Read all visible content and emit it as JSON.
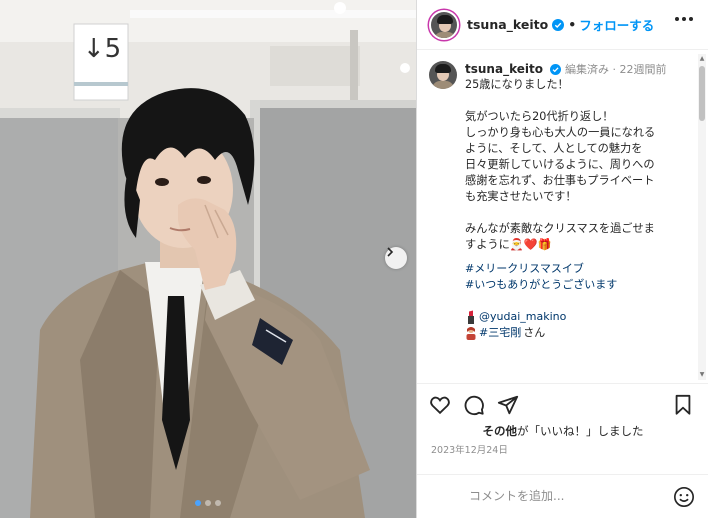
{
  "header": {
    "username": "tsuna_keito",
    "separator": "•",
    "follow_label": "フォローする"
  },
  "sign": {
    "text": "↓5"
  },
  "caption": {
    "username": "tsuna_keito",
    "edited": "編集済み",
    "dot": "·",
    "age": "22週間前",
    "text": "25歳になりました！\n\n気がついたら20代折り返し！\nしっかり身も心も大人の一員になれる\nように、そして、人としての魅力を\n日々更新していけるように、周りへの\n感謝を忘れず、お仕事もプライベート\nも充実させたいです！\n\nみんなが素敵なクリスマスを過ごせま\nすように🎅❤️🎁",
    "hashtags": [
      "#メリークリスマスイブ",
      "#いつもありがとうございます"
    ],
    "mention_1": "@yudai_makino",
    "mention_2": "#三宅剛",
    "mention_2_suffix": " さん"
  },
  "likes": {
    "others": "その他",
    "suffix": "が「いいね！」しました"
  },
  "date": "2023年12月24日",
  "comment_input": {
    "placeholder": "コメントを追加..."
  },
  "carousel": {
    "count": 3,
    "active_index": 0
  },
  "colors": {
    "accent": "#0095f6",
    "verified": "#0095f6",
    "hashtag": "#00376b",
    "dot_active": "#4aa3ff"
  },
  "icons": [
    "verified-icon",
    "more-icon",
    "chevron-right-icon",
    "heart-icon",
    "comment-icon",
    "share-icon",
    "bookmark-icon",
    "emoji-icon",
    "lipstick-icon",
    "person-icon"
  ]
}
